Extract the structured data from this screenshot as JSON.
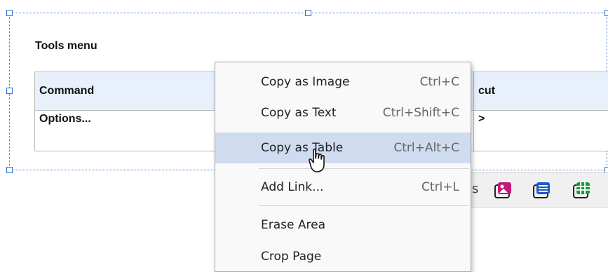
{
  "document": {
    "title": "Tools menu",
    "table": {
      "headers": [
        "Command",
        "cut"
      ],
      "rows": [
        [
          "Options...",
          ">"
        ]
      ]
    }
  },
  "context_menu": {
    "items": [
      {
        "label": "Copy as Image",
        "shortcut": "Ctrl+C"
      },
      {
        "label": "Copy as Text",
        "shortcut": "Ctrl+Shift+C"
      },
      {
        "label": "Copy as Table",
        "shortcut": "Ctrl+Alt+C",
        "highlighted": true
      },
      {
        "label": "Add Link...",
        "shortcut": "Ctrl+L"
      },
      {
        "label": "Erase Area",
        "shortcut": ""
      },
      {
        "label": "Crop Page",
        "shortcut": ""
      }
    ]
  },
  "toolbar": {
    "partial_text": "s",
    "icons": [
      "image-icon",
      "text-icon",
      "table-icon"
    ],
    "colors": {
      "image": "#c2187a",
      "text": "#1e5bc6",
      "table": "#1a9a3a"
    }
  },
  "colors": {
    "selection": "#3a7bd5",
    "highlight": "#cfdcf0",
    "header_bg": "#e7f0fb"
  }
}
